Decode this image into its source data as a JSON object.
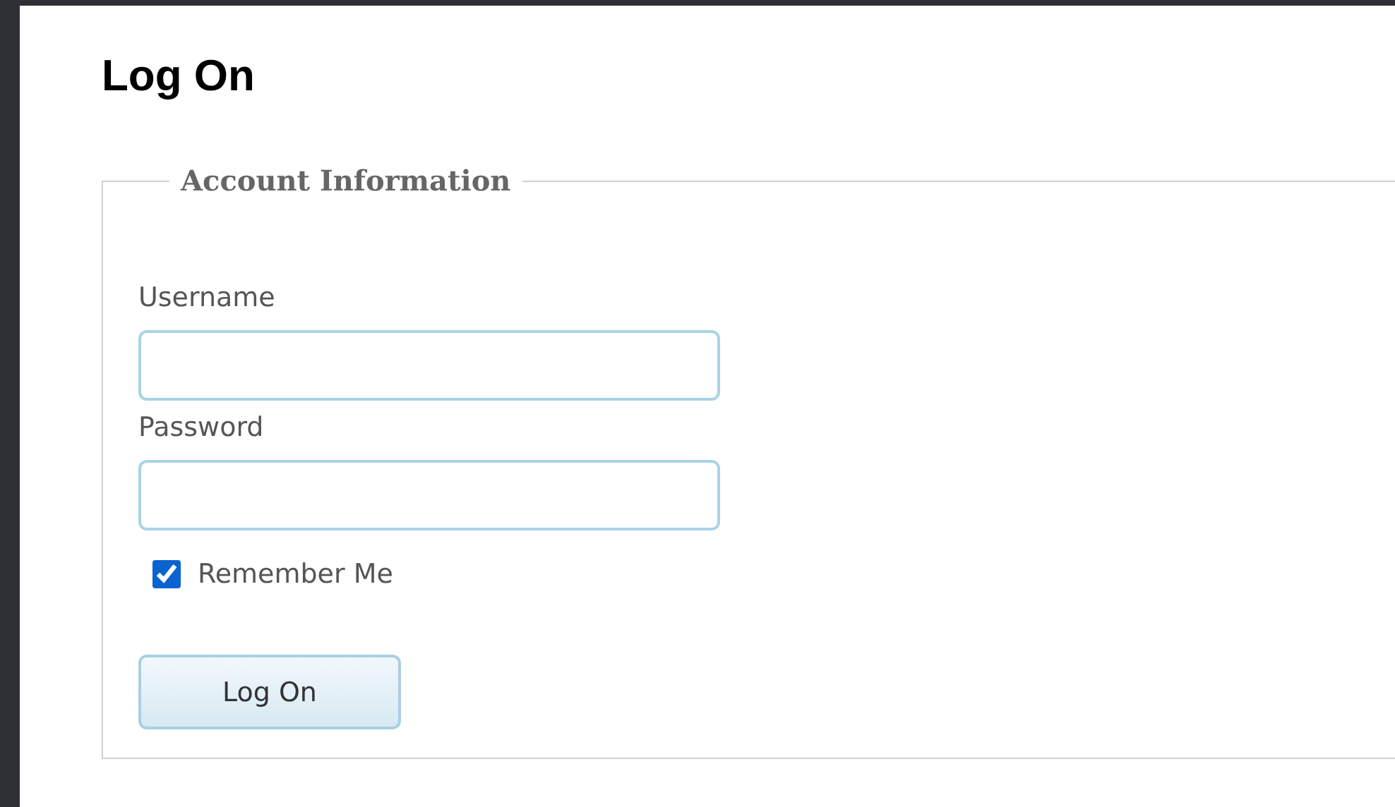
{
  "title": "Log On",
  "fieldset": {
    "legend": "Account Information",
    "fields": [
      {
        "label": "Username"
      },
      {
        "label": "Password"
      }
    ],
    "remember": {
      "label": "Remember Me",
      "checked": true
    },
    "submit": "Log On"
  }
}
